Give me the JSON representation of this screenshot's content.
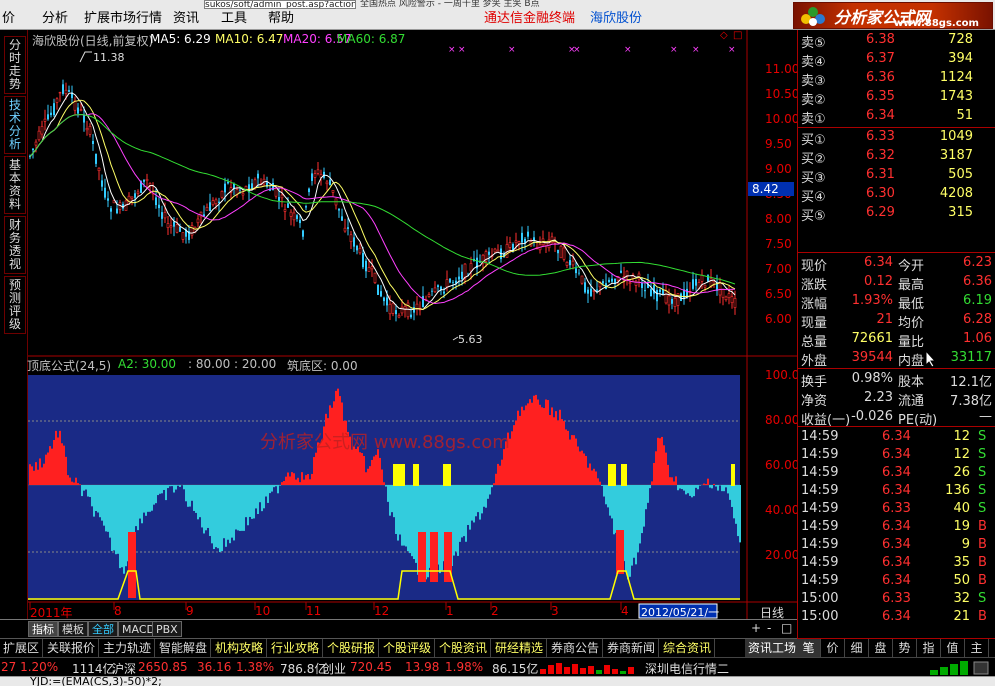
{
  "window": {
    "url_text": "sukos/soft/admin_post.asp?action=edit&channel",
    "menu": [
      "价",
      "分析",
      "扩展市场行情",
      "资讯",
      "工具",
      "帮助"
    ],
    "toolbar_text": "全国热点 风险警示 - 一周千里 梦笑 主笑 B点",
    "brand_text": "通达信金融终端",
    "stock_name_title": "海欣股份",
    "logo_text": "分析家公式网",
    "logo_url": "www.88gs.com"
  },
  "sidebar": {
    "tabs": [
      {
        "label": "分时走势",
        "active": false
      },
      {
        "label": "技术分析",
        "active": true
      },
      {
        "label": "基本资料",
        "active": false
      },
      {
        "label": "财务透视",
        "active": false
      },
      {
        "label": "预测评级",
        "active": false
      }
    ]
  },
  "main_chart": {
    "title": "海欣股份(日线,前复权)",
    "ma_labels": [
      {
        "text": "MA5: 6.29",
        "color": "#ffffff"
      },
      {
        "text": "MA10: 6.47",
        "color": "#ffff66"
      },
      {
        "text": "MA20: 6.57",
        "color": "#ff40ff"
      },
      {
        "text": "MA60: 6.87",
        "color": "#33dd33"
      }
    ],
    "high_label": "11.38",
    "low_label": "5.63",
    "price_marker": "8.42",
    "y_ticks": [
      "11.00",
      "10.50",
      "10.00",
      "9.50",
      "9.00",
      "8.50",
      "8.00",
      "7.50",
      "7.00",
      "6.50",
      "6.00"
    ]
  },
  "indicator": {
    "header": [
      {
        "text": "顶底公式(24,5)",
        "color": "#c0c0c0"
      },
      {
        "text": "A2: 30.00",
        "color": "#33dd33"
      },
      {
        "text": ": 80.00 : 20.00",
        "color": "#c0c0c0"
      },
      {
        "text": "筑底区: 0.00",
        "color": "#c0c0c0"
      }
    ],
    "watermark": "分析家公式网 www.88gs.com",
    "y_ticks": [
      "100.00",
      "80.00",
      "60.00",
      "40.00",
      "20.00"
    ]
  },
  "date_axis": {
    "labels": [
      "2011年",
      "8",
      "9",
      "10",
      "11",
      "12",
      "1",
      "2",
      "3",
      "4"
    ],
    "cursor_date": "2012/05/21/一",
    "period": "日线"
  },
  "bottom_tabs": {
    "small": [
      "指标",
      "模板",
      "全部",
      "MACD",
      "PBX"
    ],
    "info": [
      "扩展区",
      "关联报价",
      "主力轨迹",
      "智能解盘",
      "机构攻略",
      "行业攻略",
      "个股研报",
      "个股评级",
      "个股资讯",
      "研经精选",
      "券商公告",
      "券商新闻",
      "综合资讯"
    ],
    "right": "资讯工场",
    "controls": [
      "+",
      "-",
      "□"
    ]
  },
  "order_book": {
    "sell": [
      {
        "label": "卖⑤",
        "price": "6.38",
        "vol": "728"
      },
      {
        "label": "卖④",
        "price": "6.37",
        "vol": "394"
      },
      {
        "label": "卖③",
        "price": "6.36",
        "vol": "1124"
      },
      {
        "label": "卖②",
        "price": "6.35",
        "vol": "1743"
      },
      {
        "label": "卖①",
        "price": "6.34",
        "vol": "51"
      }
    ],
    "buy": [
      {
        "label": "买①",
        "price": "6.33",
        "vol": "1049"
      },
      {
        "label": "买②",
        "price": "6.32",
        "vol": "3187"
      },
      {
        "label": "买③",
        "price": "6.31",
        "vol": "505"
      },
      {
        "label": "买④",
        "price": "6.30",
        "vol": "4208"
      },
      {
        "label": "买⑤",
        "price": "6.29",
        "vol": "315"
      }
    ]
  },
  "quote": [
    {
      "l1": "现价",
      "v1": "6.34",
      "c1": "#ff3030",
      "l2": "今开",
      "v2": "6.23",
      "c2": "#ff3030"
    },
    {
      "l1": "涨跌",
      "v1": "0.12",
      "c1": "#ff3030",
      "l2": "最高",
      "v2": "6.36",
      "c2": "#ff3030"
    },
    {
      "l1": "涨幅",
      "v1": "1.93%",
      "c1": "#ff3030",
      "l2": "最低",
      "v2": "6.19",
      "c2": "#33dd33"
    },
    {
      "l1": "现量",
      "v1": "21",
      "c1": "#ff3030",
      "l2": "均价",
      "v2": "6.28",
      "c2": "#ff3030"
    },
    {
      "l1": "总量",
      "v1": "72661",
      "c1": "#ffff66",
      "l2": "量比",
      "v2": "1.06",
      "c2": "#ff3030"
    },
    {
      "l1": "外盘",
      "v1": "39544",
      "c1": "#ff3030",
      "l2": "内盘",
      "v2": "33117",
      "c2": "#33dd33"
    }
  ],
  "fundamentals": [
    {
      "l1": "换手",
      "v1": "0.98%",
      "l2": "股本",
      "v2": "12.1亿"
    },
    {
      "l1": "净资",
      "v1": "2.23",
      "l2": "流通",
      "v2": "7.38亿"
    },
    {
      "l1": "收益(一)",
      "v1": "-0.026",
      "l2": "PE(动)",
      "v2": "—"
    }
  ],
  "ticks": [
    {
      "time": "14:59",
      "price": "6.34",
      "vol": "12",
      "side": "S"
    },
    {
      "time": "14:59",
      "price": "6.34",
      "vol": "12",
      "side": "S"
    },
    {
      "time": "14:59",
      "price": "6.34",
      "vol": "26",
      "side": "S"
    },
    {
      "time": "14:59",
      "price": "6.34",
      "vol": "136",
      "side": "S"
    },
    {
      "time": "14:59",
      "price": "6.33",
      "vol": "40",
      "side": "S"
    },
    {
      "time": "14:59",
      "price": "6.34",
      "vol": "19",
      "side": "B"
    },
    {
      "time": "14:59",
      "price": "6.34",
      "vol": "9",
      "side": "B"
    },
    {
      "time": "14:59",
      "price": "6.34",
      "vol": "35",
      "side": "B"
    },
    {
      "time": "14:59",
      "price": "6.34",
      "vol": "50",
      "side": "B"
    },
    {
      "time": "15:00",
      "price": "6.33",
      "vol": "32",
      "side": "S"
    },
    {
      "time": "15:00",
      "price": "6.34",
      "vol": "21",
      "side": "B"
    }
  ],
  "right_tabs": [
    "笔",
    "价",
    "细",
    "盘",
    "势",
    "指",
    "值",
    "主"
  ],
  "status_bar": {
    "first_pct": "27  1.20%",
    "first_amt": "1114亿",
    "idx1_name": "沪深",
    "idx1_val": "2650.85",
    "idx1_chg": "36.16",
    "idx1_pct": "1.38%",
    "idx1_amt": "786.8亿",
    "idx2_name": "创业",
    "idx2_val": "720.45",
    "idx2_chg": "13.98",
    "idx2_pct": "1.98%",
    "idx2_amt": "86.15亿",
    "server": "深圳电信行情二"
  },
  "formula_strip": "YJD:=(EMA(CS,3)-50)*2;"
}
